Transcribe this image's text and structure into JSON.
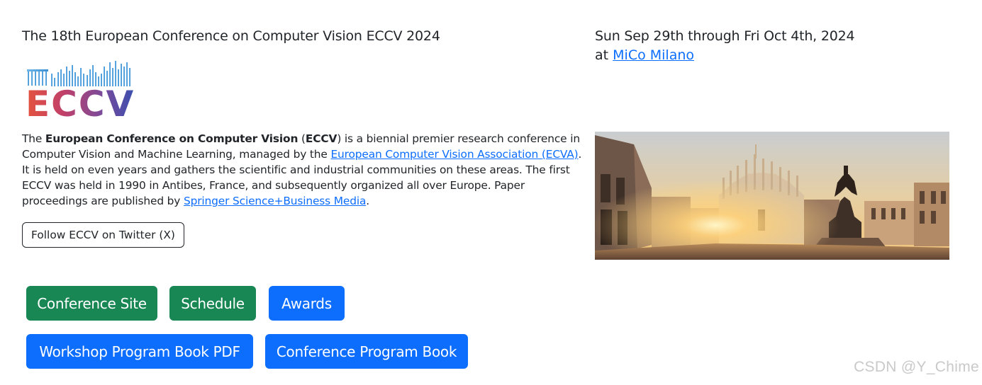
{
  "left": {
    "title": "The 18th European Conference on Computer Vision ECCV 2024",
    "logo_text": "ECCV",
    "description": {
      "p1": "The ",
      "b1": "European Conference on Computer Vision",
      "p2": " (",
      "b2": "ECCV",
      "p3": ") is a biennial premier research conference in Computer Vision and Machine Learning, managed by the ",
      "link1": "European Computer Vision Association (ECVA)",
      "p4": ". It is held on even years and gathers the scientific and industrial communities on these areas. The first ECCV was held in 1990 in Antibes, France, and subsequently organized all over Europe. Paper proceedings are published by ",
      "link2": "Springer Science+Business Media",
      "p5": "."
    },
    "twitter_button": "Follow ECCV on Twitter (X)",
    "buttons": {
      "conference_site": "Conference Site",
      "schedule": "Schedule",
      "awards": "Awards",
      "workshop_book": "Workshop Program Book PDF",
      "conference_book": "Conference Program Book"
    }
  },
  "right": {
    "dates": "Sun Sep 29th through Fri Oct 4th, 2024",
    "venue_prefix": "at ",
    "venue_link": "MiCo Milano"
  },
  "colors": {
    "green": "#198754",
    "blue": "#0d6efd",
    "link": "#0d6efd"
  },
  "watermark": "CSDN @Y_Chime"
}
